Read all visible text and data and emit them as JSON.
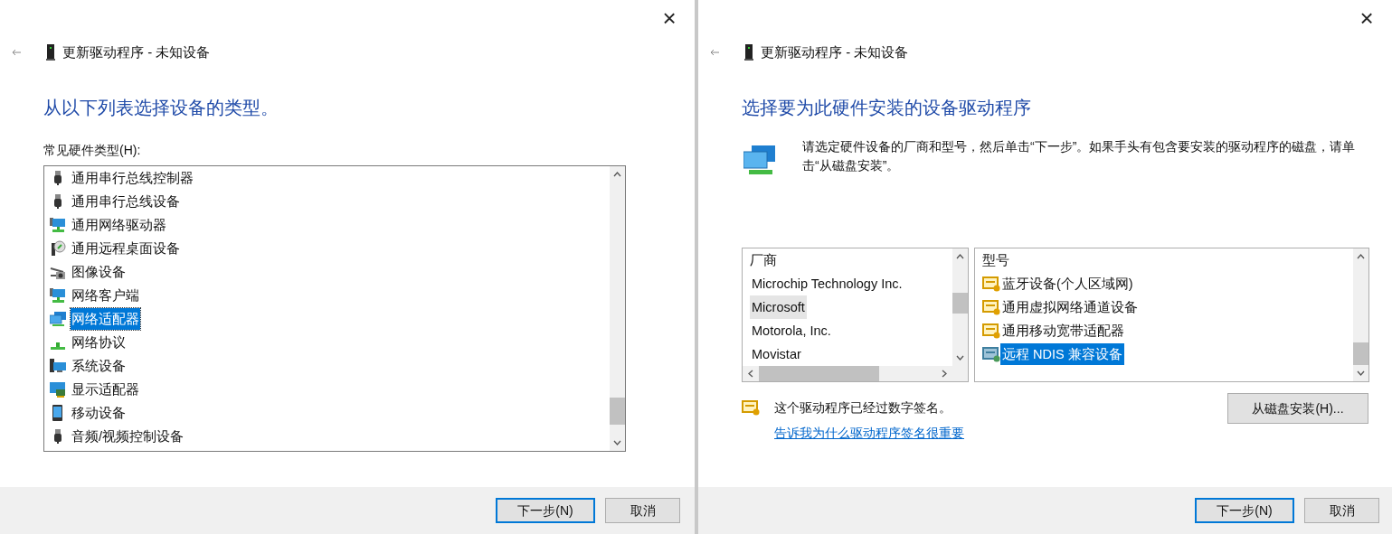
{
  "left_dialog": {
    "title": "更新驱动程序 - 未知设备",
    "close": "×",
    "heading": "从以下列表选择设备的类型。",
    "list_label": "常见硬件类型(H):",
    "hardware_types": [
      {
        "label": "通用串行总线控制器",
        "kind": "usb",
        "selected": false
      },
      {
        "label": "通用串行总线设备",
        "kind": "usb",
        "selected": false
      },
      {
        "label": "通用网络驱动器",
        "kind": "netdrive",
        "selected": false
      },
      {
        "label": "通用远程桌面设备",
        "kind": "remote",
        "selected": false
      },
      {
        "label": "图像设备",
        "kind": "camera",
        "selected": false
      },
      {
        "label": "网络客户端",
        "kind": "netdrive",
        "selected": false
      },
      {
        "label": "网络适配器",
        "kind": "network",
        "selected": true
      },
      {
        "label": "网络协议",
        "kind": "protocol",
        "selected": false
      },
      {
        "label": "系统设备",
        "kind": "system",
        "selected": false
      },
      {
        "label": "显示适配器",
        "kind": "display",
        "selected": false
      },
      {
        "label": "移动设备",
        "kind": "mobile",
        "selected": false
      },
      {
        "label": "音频/视频控制设备",
        "kind": "usb",
        "selected": false
      }
    ],
    "buttons": [
      {
        "label": "下一步(N)",
        "default": true
      },
      {
        "label": "取消",
        "default": false
      }
    ]
  },
  "right_dialog": {
    "title": "更新驱动程序 - 未知设备",
    "close": "×",
    "heading": "选择要为此硬件安装的设备驱动程序",
    "instructions": "请选定硬件设备的厂商和型号，然后单击“下一步”。如果手头有包含要安装的驱动程序的磁盘，请单击“从磁盘安装”。",
    "vendor_header": "厂商",
    "vendors": [
      {
        "label": "Microchip Technology Inc.",
        "selected": false
      },
      {
        "label": "Microsoft",
        "selected": true
      },
      {
        "label": "Motorola, Inc.",
        "selected": false
      },
      {
        "label": "Movistar",
        "selected": false
      }
    ],
    "model_header": "型号",
    "models": [
      {
        "label": "蓝牙设备(个人区域网)",
        "selected": false
      },
      {
        "label": "通用虚拟网络通道设备",
        "selected": false
      },
      {
        "label": "通用移动宽带适配器",
        "selected": false
      },
      {
        "label": "远程 NDIS 兼容设备",
        "selected": true
      }
    ],
    "signed_note": "这个驱动程序已经过数字签名。",
    "link": "告诉我为什么驱动程序签名很重要",
    "disk_button": "从磁盘安装(H)...",
    "buttons": [
      {
        "label": "下一步(N)",
        "default": true
      },
      {
        "label": "取消",
        "default": false
      }
    ]
  }
}
